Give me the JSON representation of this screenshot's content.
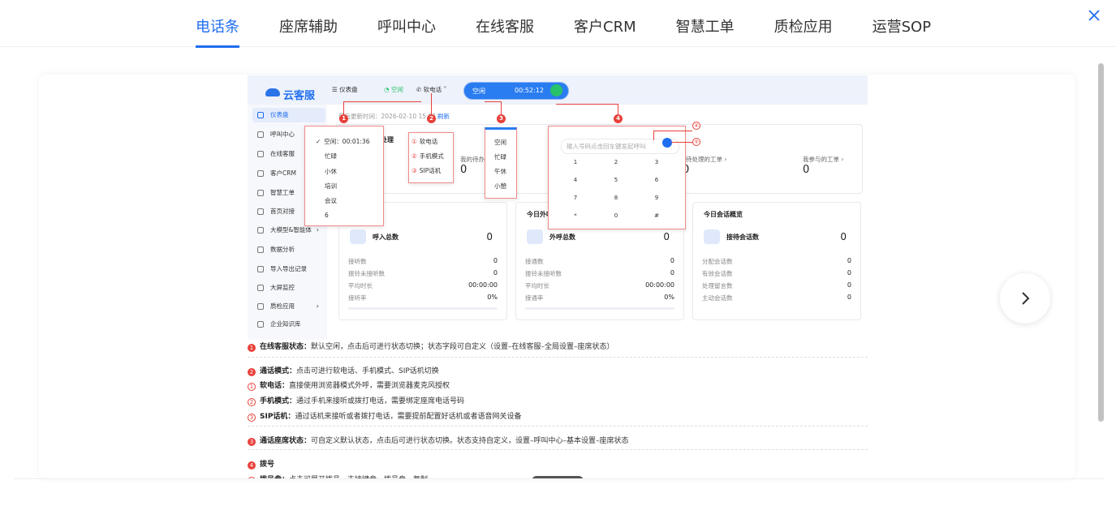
{
  "tabs": [
    "电话条",
    "座席辅助",
    "呼叫中心",
    "在线客服",
    "客户CRM",
    "智慧工单",
    "质检应用",
    "运营SOP"
  ],
  "active_tab": "电话条",
  "icons": {
    "close": "close-icon",
    "next": "chevron-right-icon"
  },
  "colors": {
    "accent": "#1f6ef0",
    "marker": "#e8413b",
    "call_green": "#27c269"
  },
  "inner": {
    "logo": "云客服",
    "header": {
      "dashboard": "仪表盘",
      "status": "空闲",
      "softphone": "软电话",
      "pill_status": "空闲",
      "timer": "00:52:12"
    },
    "refresh": {
      "label": "最后更新时间：2026-02-10 15:02",
      "link": "刷新"
    },
    "sidebar": [
      "仪表盘",
      "呼叫中心",
      "在线客服",
      "客户CRM",
      "智慧工单",
      "首页对接",
      "大模型&智能体",
      "数据分析",
      "导入导出记录",
      "大屏监控",
      "质检应用",
      "企业知识库"
    ],
    "pending": {
      "title": "处理",
      "my_pending": "我的待办",
      "my_value": "0",
      "wait": "待处理的工单",
      "wait_value": "0",
      "part": "我参与的工单",
      "part_value": "0"
    },
    "popup1": {
      "items": [
        "空闲：00:01:36",
        "忙碌",
        "小休",
        "培训",
        "会议",
        "6"
      ]
    },
    "popup2": {
      "items": [
        "软电话",
        "手机模式",
        "SIP话机"
      ],
      "nums": [
        "①",
        "②",
        "③"
      ]
    },
    "popup3": {
      "items": [
        "空闲",
        "忙碌",
        "午休",
        "小憩"
      ]
    },
    "dialpad": {
      "placeholder": "输入号码点击回车键发起呼叫",
      "keys": [
        "1",
        "2",
        "3",
        "4",
        "5",
        "6",
        "7",
        "8",
        "9",
        "*",
        "0",
        "#"
      ]
    },
    "markers": [
      "1",
      "2",
      "3",
      "4",
      "④",
      "⑤"
    ],
    "card_in": {
      "title": "",
      "main_label": "呼入总数",
      "main_value": "0",
      "rows": [
        [
          "接听数",
          "0"
        ],
        [
          "振铃未接听数",
          "0"
        ],
        [
          "平均时长",
          "00:00:00"
        ],
        [
          "接听率",
          "0%"
        ]
      ]
    },
    "card_out": {
      "title": "今日外呼",
      "main_label": "外呼总数",
      "main_value": "0",
      "rows": [
        [
          "接通数",
          "0"
        ],
        [
          "振铃未接听数",
          "0"
        ],
        [
          "平均时长",
          "00:00:00"
        ],
        [
          "接通率",
          "0%"
        ]
      ]
    },
    "card_chat": {
      "title": "今日会话概览",
      "main_label": "接待会话数",
      "main_value": "0",
      "rows": [
        [
          "分配会话数",
          "0"
        ],
        [
          "有效会话数",
          "0"
        ],
        [
          "处理留言数",
          "0"
        ],
        [
          "主动会话数",
          "0"
        ]
      ]
    }
  },
  "notes": [
    {
      "num": "1",
      "type": "fill",
      "bold": "在线客服状态：",
      "text": "默认空闲，点击后可进行状态切换；状态字段可自定义（设置–在线客服–全局设置–座席状态）"
    },
    {
      "num": "2",
      "type": "fill",
      "bold": "通话模式：",
      "text": "点击可进行软电话、手机模式、SIP话机切换"
    },
    {
      "num": "1",
      "type": "ring",
      "bold": "软电话：",
      "text": "直接使用浏览器模式外呼，需要浏览器麦克风授权"
    },
    {
      "num": "2",
      "type": "ring",
      "bold": "手机模式：",
      "text": "通过手机来接听或拨打电话，需要绑定座席电话号码"
    },
    {
      "num": "3",
      "type": "ring",
      "bold": "SIP话机：",
      "text": "通过话机来接听或者拨打电话，需要提前配置好话机或者语音网关设备"
    },
    {
      "num": "3",
      "type": "fill",
      "bold": "通话座席状态：",
      "text": "可自定义默认状态，点击后可进行状态切换。状态支持自定义，设置–呼叫中心–基本设置–座席状态"
    },
    {
      "num": "4",
      "type": "fill",
      "bold": "拨号",
      "text": ""
    },
    {
      "num": "1",
      "type": "ring",
      "bold": "拨号盘：",
      "text": "点击可展开拨号，支持键盘、拨号盘、复制"
    }
  ]
}
